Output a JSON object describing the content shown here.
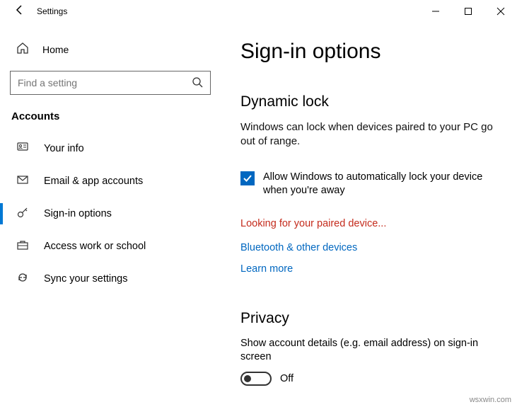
{
  "titlebar": {
    "title": "Settings"
  },
  "sidebar": {
    "home_label": "Home",
    "search_placeholder": "Find a setting",
    "section": "Accounts",
    "items": [
      {
        "label": "Your info"
      },
      {
        "label": "Email & app accounts"
      },
      {
        "label": "Sign-in options"
      },
      {
        "label": "Access work or school"
      },
      {
        "label": "Sync your settings"
      }
    ]
  },
  "content": {
    "page_title": "Sign-in options",
    "dynamic_lock": {
      "heading": "Dynamic lock",
      "description": "Windows can lock when devices paired to your PC go out of range.",
      "checkbox_label": "Allow Windows to automatically lock your device when you're away",
      "status": "Looking for your paired device...",
      "link_bluetooth": "Bluetooth & other devices",
      "link_learn": "Learn more"
    },
    "privacy": {
      "heading": "Privacy",
      "toggle_description": "Show account details (e.g. email address) on sign-in screen",
      "toggle_state": "Off"
    }
  },
  "watermark": "wsxwin.com"
}
